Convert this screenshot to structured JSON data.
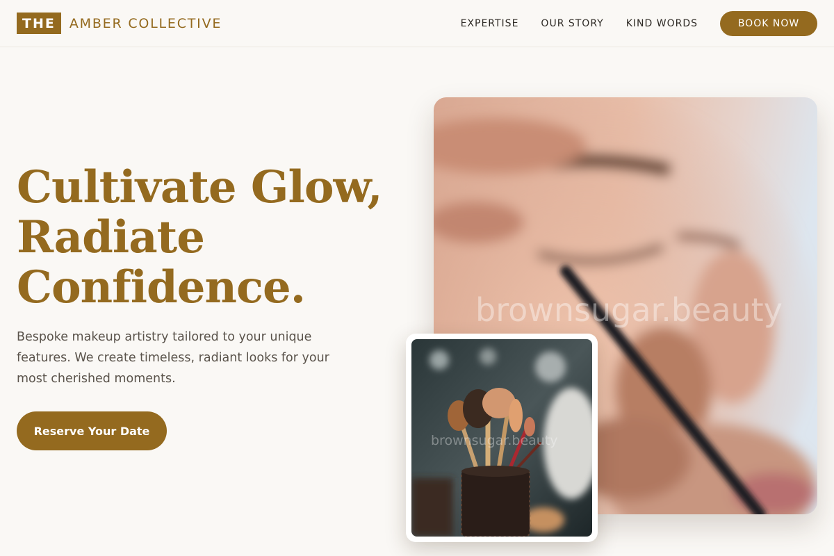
{
  "header": {
    "brand_badge": "THE",
    "brand_name": "AMBER COLLECTIVE",
    "nav": [
      "EXPERTISE",
      "OUR STORY",
      "KIND WORDS"
    ],
    "book_label": "BOOK NOW"
  },
  "hero": {
    "title_lines": [
      "Cultivate Glow,",
      "Radiate",
      "Confidence."
    ],
    "description": "Bespoke makeup artistry tailored to your unique features. We create timeless, radiant looks for your most cherished moments.",
    "cta_label": "Reserve Your Date"
  },
  "images": {
    "main_watermark": "brownsugar.beauty",
    "inset_watermark": "brownsugar.beauty"
  },
  "colors": {
    "accent": "#946a1f",
    "background": "#faf8f5",
    "text": "#2e2a25",
    "muted_text": "#5a534b"
  }
}
